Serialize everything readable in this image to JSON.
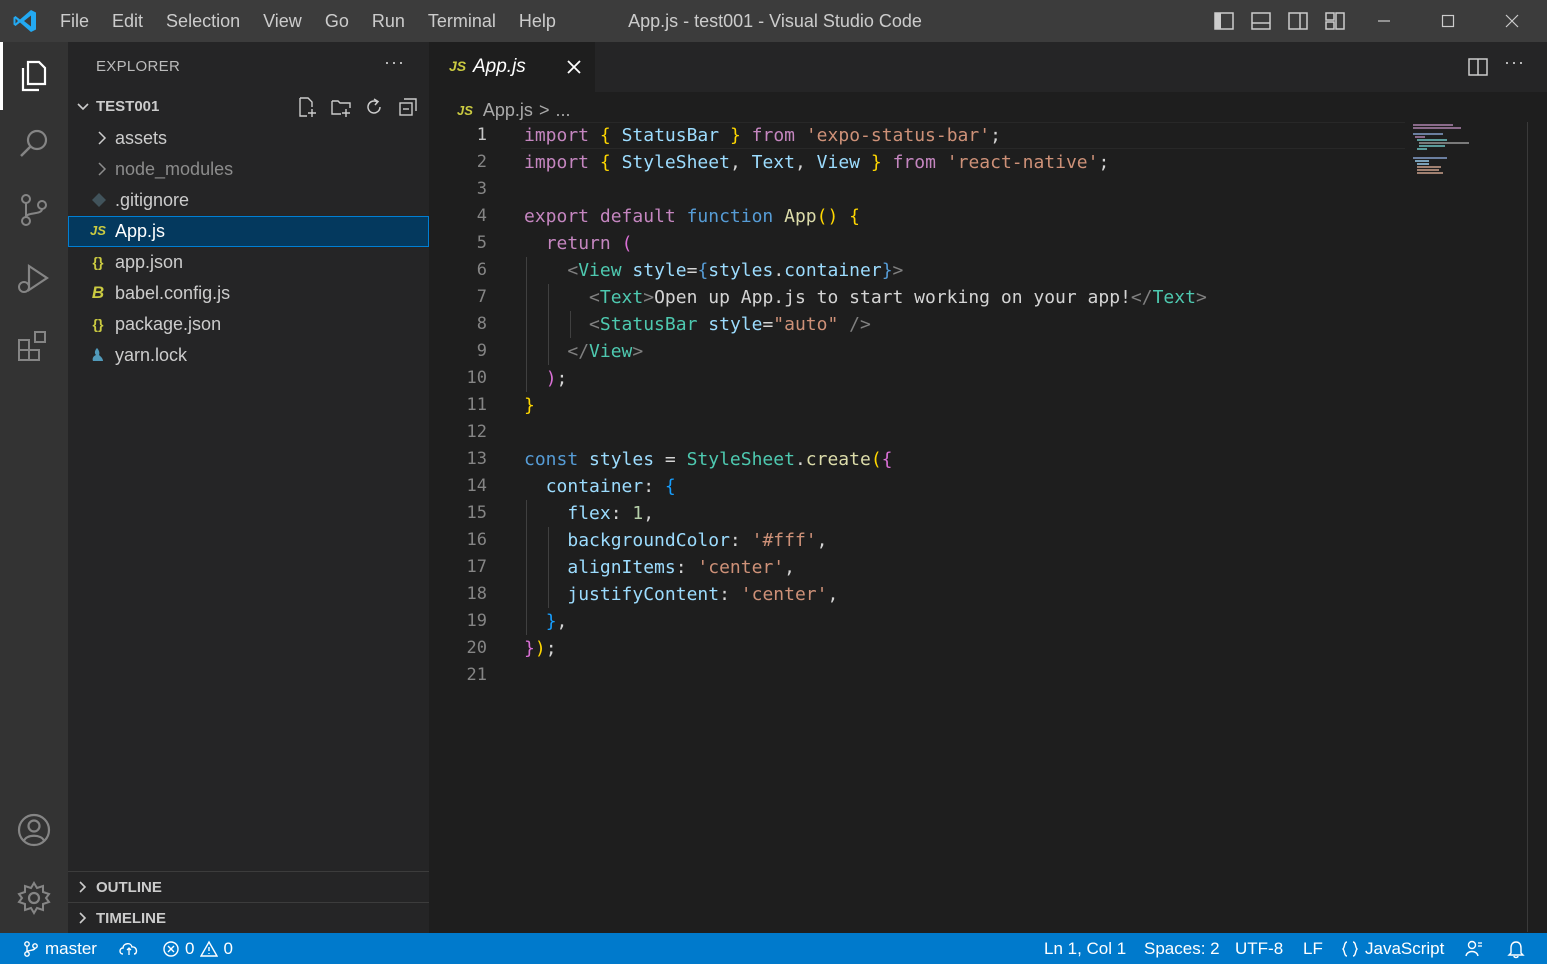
{
  "window": {
    "title": "App.js - test001 - Visual Studio Code",
    "menu": [
      "File",
      "Edit",
      "Selection",
      "View",
      "Go",
      "Run",
      "Terminal",
      "Help"
    ]
  },
  "explorer": {
    "title": "EXPLORER",
    "more": "···",
    "folder": "TEST001",
    "items": [
      {
        "label": "assets",
        "kind": "folder",
        "icon": "chevron-right-icon"
      },
      {
        "label": "node_modules",
        "kind": "folder",
        "icon": "chevron-right-icon",
        "dim": true
      },
      {
        "label": ".gitignore",
        "kind": "file",
        "icon": "git-file-icon"
      },
      {
        "label": "App.js",
        "kind": "file",
        "icon": "js-file-icon",
        "icon_text": "JS",
        "selected": true
      },
      {
        "label": "app.json",
        "kind": "file",
        "icon": "json-file-icon",
        "icon_text": "{}"
      },
      {
        "label": "babel.config.js",
        "kind": "file",
        "icon": "babel-file-icon",
        "icon_text": "B"
      },
      {
        "label": "package.json",
        "kind": "file",
        "icon": "json-file-icon",
        "icon_text": "{}"
      },
      {
        "label": "yarn.lock",
        "kind": "file",
        "icon": "yarn-file-icon"
      }
    ],
    "sections": [
      "OUTLINE",
      "TIMELINE"
    ]
  },
  "editor": {
    "tab": {
      "icon_text": "JS",
      "label": "App.js"
    },
    "breadcrumb": {
      "icon_text": "JS",
      "file": "App.js",
      "separator": ">",
      "rest": "..."
    },
    "more": "···",
    "line_numbers": [
      "1",
      "2",
      "3",
      "4",
      "5",
      "6",
      "7",
      "8",
      "9",
      "10",
      "11",
      "12",
      "13",
      "14",
      "15",
      "16",
      "17",
      "18",
      "19",
      "20",
      "21"
    ],
    "current_line": 1,
    "code": [
      "import { StatusBar } from 'expo-status-bar';",
      "import { StyleSheet, Text, View } from 'react-native';",
      "",
      "export default function App() {",
      "  return (",
      "    <View style={styles.container}>",
      "      <Text>Open up App.js to start working on your app!</Text>",
      "      <StatusBar style=\"auto\" />",
      "    </View>",
      "  );",
      "}",
      "",
      "const styles = StyleSheet.create({",
      "  container: {",
      "    flex: 1,",
      "    backgroundColor: '#fff',",
      "    alignItems: 'center',",
      "    justifyContent: 'center',",
      "  },",
      "});",
      ""
    ]
  },
  "statusbar": {
    "branch": "master",
    "errors": "0",
    "warnings": "0",
    "position": "Ln 1, Col 1",
    "spaces": "Spaces: 2",
    "encoding": "UTF-8",
    "eol": "LF",
    "language": "JavaScript"
  },
  "colors": {
    "accent": "#007acc",
    "titlebar": "#3c3c3c",
    "activitybar": "#333333",
    "sidebar": "#252526",
    "editor": "#1e1e1e",
    "selection": "#04395e"
  }
}
